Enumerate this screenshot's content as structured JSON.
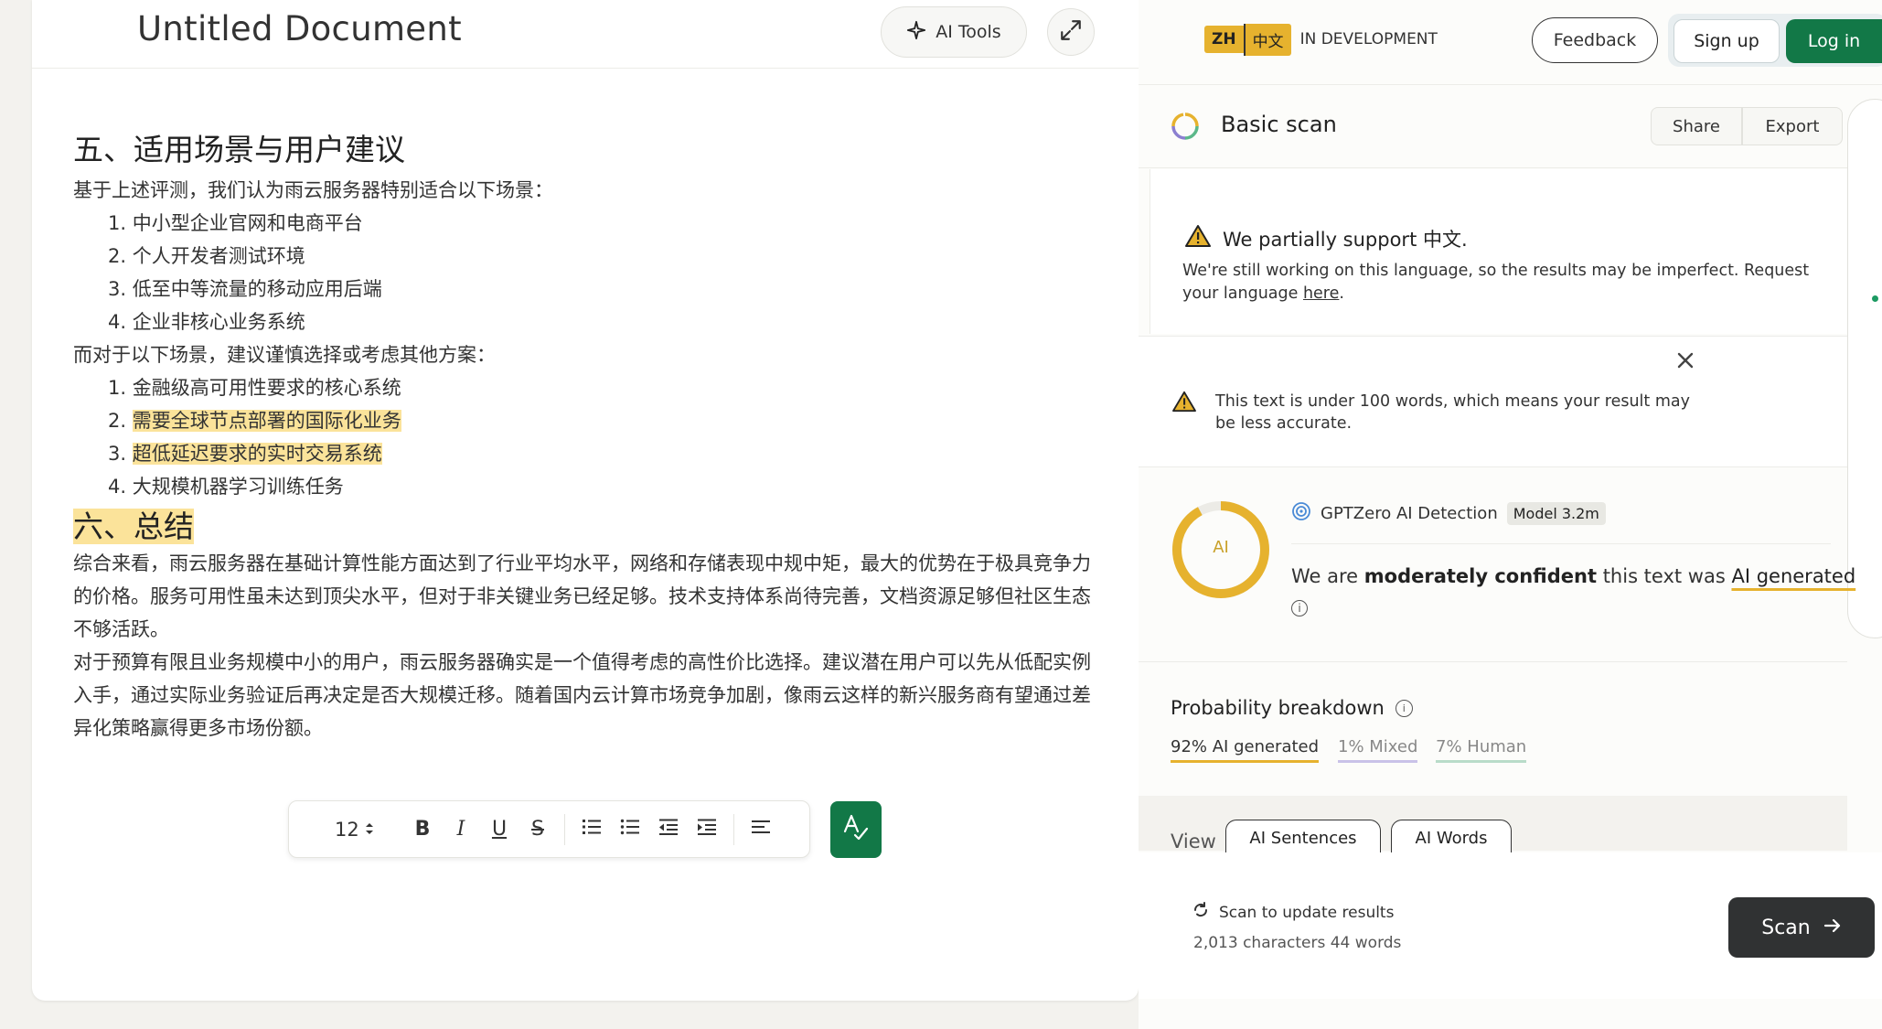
{
  "editor": {
    "title": "Untitled Document",
    "ai_tools_label": "AI Tools",
    "sections": {
      "heading5": "五、适用场景与用户建议",
      "intro": "基于上述评测，我们认为雨云服务器特别适合以下场景：",
      "suitable": [
        "1. 中小型企业官网和电商平台",
        "2. 个人开发者测试环境",
        "3. 低至中等流量的移动应用后端",
        "4. 企业非核心业务系统"
      ],
      "caution_intro": "而对于以下场景，建议谨慎选择或考虑其他方案：",
      "caution": [
        "1. 金融级高可用性要求的核心系统",
        "2. 需要全球节点部署的国际化业务",
        "3. 超低延迟要求的实时交易系统",
        "4. 大规模机器学习训练任务"
      ],
      "caution_num2": "2.",
      "caution_text2": "需要全球节点部署的国际化业务",
      "caution_num3": "3.",
      "caution_text3": "超低延迟要求的实时交易系统",
      "heading6": "六、总结",
      "para1": "综合来看，雨云服务器在基础计算性能方面达到了行业平均水平，网络和存储表现中规中矩，最大的优势在于极具竞争力的价格。服务可用性虽未达到顶尖水平，但对于非关键业务已经足够。技术支持体系尚待完善，文档资源足够但社区生态不够活跃。",
      "para2": "对于预算有限且业务规模中小的用户，雨云服务器确实是一个值得考虑的高性价比选择。建议潜在用户可以先从低配实例入手，通过实际业务验证后再决定是否大规模迁移。随着国内云计算市场竞争加剧，像雨云这样的新兴服务商有望通过差异化策略赢得更多市场份额。"
    },
    "toolbar": {
      "font_size": "12",
      "bold": "B",
      "italic": "I",
      "underline": "U",
      "strike": "S"
    }
  },
  "header": {
    "lang_code": "ZH",
    "lang_name": "中文",
    "status": "IN DEVELOPMENT",
    "feedback": "Feedback",
    "signup": "Sign up",
    "login": "Log in"
  },
  "scan": {
    "title": "Basic scan",
    "share": "Share",
    "export": "Export"
  },
  "notices": {
    "lang_title": "We partially support 中文.",
    "lang_text": "We're still working on this language, so the results may be imperfect. Request your language ",
    "lang_link": "here",
    "lang_end": ".",
    "short_text": "This text is under 100 words, which means your result may be less accurate."
  },
  "result": {
    "ring_label": "AI",
    "ai_fraction": 0.92,
    "detector": "GPTZero AI Detection",
    "model": "Model 3.2m",
    "confidence_pre": "We are ",
    "confidence_bold": "moderately confident",
    "confidence_mid": " this text was ",
    "confidence_ai": "AI generated"
  },
  "probability": {
    "title": "Probability breakdown",
    "ai": "92% AI generated",
    "mixed": "1% Mixed",
    "human": "7% Human"
  },
  "view": {
    "label": "View",
    "tab_sentences": "AI Sentences",
    "tab_words": "AI Words"
  },
  "footer": {
    "scan_update": "Scan to update results",
    "char_count": "2,013 characters 44 words",
    "scan_btn": "Scan"
  },
  "colors": {
    "accent_green": "#127847",
    "ai_yellow": "#e6b22e",
    "highlight": "#fbe39a"
  }
}
